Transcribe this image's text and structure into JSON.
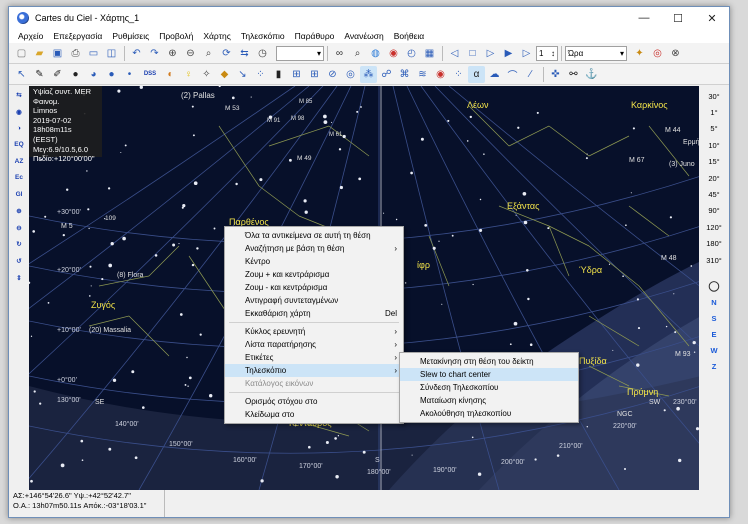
{
  "window": {
    "title": "Cartes du Ciel - Χάρτης_1",
    "minimize": "—",
    "maximize": "☐",
    "close": "✕"
  },
  "menu": [
    "Αρχείο",
    "Επεξεργασία",
    "Ρυθμίσεις",
    "Προβολή",
    "Χάρτης",
    "Τηλεσκόπιο",
    "Παράθυρο",
    "Ανανέωση",
    "Βοήθεια"
  ],
  "toolbar1": {
    "date_combo": "",
    "step_value": "1",
    "time_unit": "Ώρα"
  },
  "toolbar2": {
    "dss_label": "DSS"
  },
  "left_tools": [
    "⇆",
    "◉",
    "◑",
    "EQ",
    "AZ",
    "Ec",
    "Gl",
    "⊕",
    "⊖",
    "↻",
    "↺",
    "⇕"
  ],
  "right_fov": [
    "30°",
    "1°",
    "5°",
    "10°",
    "15°",
    "20°",
    "45°",
    "90°",
    "120°",
    "180°",
    "310°"
  ],
  "right_dirs": [
    "N",
    "S",
    "E",
    "W",
    "Z"
  ],
  "info": {
    "line1": "Υψίαζ συντ. MER",
    "line2": "Φαινομ.",
    "line3": "Limnos",
    "line4": "2019-07-02",
    "line5": "18h08m11s (EEST)",
    "line6": "Μεγ:6.9/10.5,6.0",
    "line7": "Πεδίο:+120°00'00\""
  },
  "sky_labels": {
    "pallas": "(2) Pallas",
    "m53": "M 53",
    "m85": "M 85",
    "m91": "M 91",
    "m98": "M 98",
    "m61": "M 61",
    "m49": "M 49",
    "leon": "Λέων",
    "karkinos": "Καρκίνος",
    "m44": "M 44",
    "ermis": "Ερμής",
    "m67": "M 67",
    "juno": "(3) Juno",
    "parthenos": "Παρθένος",
    "exantas": "Εξάντας",
    "ydra": "Ύδρα",
    "m48": "M 48",
    "m5": "M 5",
    "n109": "109",
    "flora": "(8) Flora",
    "zygos": "Ζυγός",
    "massalia": "(20) Massalia",
    "ofr": "ίφρ",
    "pyxida": "Πυξίδα",
    "m93": "M 93",
    "pryni": "Πρύμνη",
    "ngc": "NGC",
    "sw": "SW",
    "se": "SE",
    "kentavros": "Κένταυρος",
    "dec30": "+30°00'",
    "dec20": "+20°00'",
    "dec10": "+10°00'",
    "dec0": "+0°00'",
    "ra130": "130°00'",
    "ra140": "140°00'",
    "ra150": "150°00'",
    "ra160": "160°00'",
    "ra170": "170°00'",
    "ra180": "180°00'",
    "ra190": "190°00'",
    "ra200": "200°00'",
    "ra210": "210°00'",
    "ra220": "220°00'",
    "ra230": "230°00'",
    "s": "S"
  },
  "context_menu": {
    "items": [
      {
        "label": "Όλα τα αντικείμενα σε αυτή τη θέση",
        "arrow": ""
      },
      {
        "label": "Αναζήτηση με βάση τη θέση",
        "arrow": "›"
      },
      {
        "label": "Κέντρο",
        "arrow": ""
      },
      {
        "label": "Ζουμ + και κεντράρισμα",
        "arrow": ""
      },
      {
        "label": "Ζουμ - και κεντράρισμα",
        "arrow": ""
      },
      {
        "label": "Αντιγραφή συντεταγμένων",
        "arrow": ""
      },
      {
        "label": "Εκκαθάριση χάρτη",
        "arrow": "Del"
      }
    ],
    "items2": [
      {
        "label": "Κύκλος ερευνητή",
        "arrow": "›"
      },
      {
        "label": "Λίστα παρατήρησης",
        "arrow": "›"
      },
      {
        "label": "Ετικέτες",
        "arrow": "›"
      },
      {
        "label": "Τηλεσκόπιο",
        "arrow": "›"
      },
      {
        "label": "Κατάλογος εικόνων",
        "arrow": ""
      }
    ],
    "items3": [
      {
        "label": "Ορισμός στόχου στο",
        "arrow": ""
      },
      {
        "label": "Κλείδωμα στο",
        "arrow": ""
      }
    ]
  },
  "submenu": {
    "items": [
      "Μετακίνηση στη θέση του δείκτη",
      "Slew to chart center",
      "Σύνδεση Τηλεσκοπίου",
      "Ματαίωση κίνησης",
      "Ακολούθηση τηλεσκοπίου"
    ]
  },
  "status": {
    "line1": "ΑΣ:+146°54'26.6\" Υψ.:+42°52'42.7\"",
    "line2": "Ο.Α.: 13h07m50.11s Απόκ.:-03°18'03.1\""
  },
  "colors": {
    "sky": "#07102a",
    "grid": "#3a4e8a",
    "constellation": "#c8d27a",
    "highlight": "#cce4f7",
    "label_yellow": "#f2e34a"
  }
}
